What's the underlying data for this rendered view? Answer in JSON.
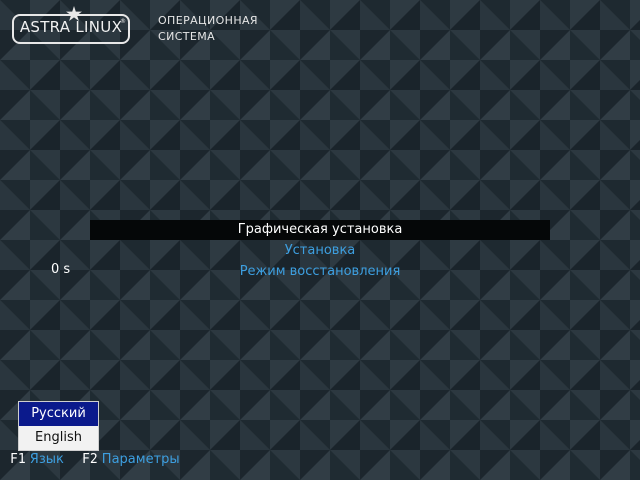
{
  "brand": {
    "logo_text": "ASTRA LINUX",
    "registered_mark": "®",
    "tagline_line1": "ОПЕРАЦИОННАЯ",
    "tagline_line2": "СИСТЕМА"
  },
  "boot_menu": {
    "items": [
      {
        "label": "Графическая установка",
        "selected": true
      },
      {
        "label": "Установка",
        "selected": false
      },
      {
        "label": "Режим восстановления",
        "selected": false
      }
    ],
    "timeout": "0 s"
  },
  "language_menu": {
    "options": [
      {
        "label": "Русский",
        "active": true
      },
      {
        "label": "English",
        "active": false
      }
    ]
  },
  "hotkeys": [
    {
      "key": "F1",
      "label": "Язык"
    },
    {
      "key": "F2",
      "label": "Параметры"
    }
  ],
  "colors": {
    "background": "#26323a",
    "accent": "#3d9fe0",
    "selected_bg": "#050708",
    "lang_active_bg": "#0b1a8c"
  }
}
